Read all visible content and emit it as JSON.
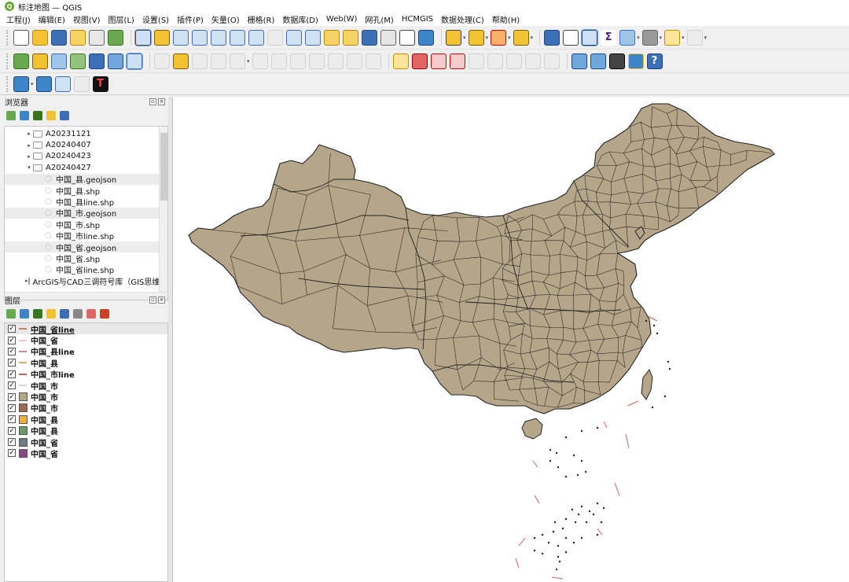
{
  "window": {
    "title": "标注地图 — QGIS",
    "logo_letter": "Q"
  },
  "menu": [
    "工程(J)",
    "编辑(E)",
    "视图(V)",
    "图层(L)",
    "设置(S)",
    "插件(P)",
    "矢量(O)",
    "栅格(R)",
    "数据库(D)",
    "Web(W)",
    "网孔(M)",
    "HCMGIS",
    "数据处理(C)",
    "帮助(H)"
  ],
  "toolbar_icons": {
    "row1": [
      {
        "name": "new-project-icon",
        "color": "#ffffff",
        "border": "#555"
      },
      {
        "name": "open-project-icon",
        "color": "#f1c232",
        "border": "#b8860b"
      },
      {
        "name": "save-project-icon",
        "color": "#3d6fb6",
        "border": "#2b4f85"
      },
      {
        "name": "new-print-layout-icon",
        "color": "#f6d365",
        "border": "#b8860b"
      },
      {
        "name": "layout-manager-icon",
        "color": "#e8e8e8",
        "border": "#666"
      },
      {
        "name": "style-manager-icon",
        "color": "#6aa84f",
        "border": "#38761d"
      },
      {
        "sep": true
      },
      {
        "name": "pan-map-icon",
        "color": "#ffffff",
        "border": "#444",
        "selected": true
      },
      {
        "name": "pan-to-selection-icon",
        "color": "#f1c232",
        "border": "#7f6000"
      },
      {
        "name": "zoom-in-icon",
        "color": "#cfe2f3",
        "border": "#3d6fb6"
      },
      {
        "name": "zoom-out-icon",
        "color": "#cfe2f3",
        "border": "#3d6fb6"
      },
      {
        "name": "zoom-full-icon",
        "color": "#cfe2f3",
        "border": "#3d6fb6"
      },
      {
        "name": "zoom-to-selection-icon",
        "color": "#cfe2f3",
        "border": "#3d6fb6"
      },
      {
        "name": "zoom-to-layer-icon",
        "color": "#cfe2f3",
        "border": "#3d6fb6"
      },
      {
        "name": "zoom-native-icon",
        "color": "#e6e6e6",
        "border": "#999",
        "disabled": true
      },
      {
        "name": "zoom-last-icon",
        "color": "#cfe2f3",
        "border": "#3d6fb6"
      },
      {
        "name": "zoom-next-icon",
        "color": "#cfe2f3",
        "border": "#3d6fb6"
      },
      {
        "name": "new-map-view-icon",
        "color": "#f6d365",
        "border": "#b8860b"
      },
      {
        "name": "new-3d-view-icon",
        "color": "#f6d365",
        "border": "#b8860b"
      },
      {
        "name": "bookmark-new-icon",
        "color": "#3d6fb6",
        "border": "#2b4f85"
      },
      {
        "name": "bookmarks-icon",
        "color": "#e6e6e6",
        "border": "#666"
      },
      {
        "name": "temporal-controller-icon",
        "color": "#ffffff",
        "border": "#444"
      },
      {
        "name": "refresh-icon",
        "color": "#3d85c6",
        "border": "#1c4587"
      },
      {
        "sep": true
      },
      {
        "name": "select-features-icon",
        "color": "#f1c232",
        "border": "#444",
        "dropdown": true
      },
      {
        "name": "select-by-value-icon",
        "color": "#f1c232",
        "border": "#7f6000",
        "dropdown": true
      },
      {
        "name": "deselect-icon",
        "color": "#f6b26b",
        "border": "#cc0000",
        "dropdown": true
      },
      {
        "name": "select-by-expression-icon",
        "color": "#f1c232",
        "border": "#7f6000",
        "dropdown": true
      },
      {
        "sep": true
      },
      {
        "name": "identify-features-icon",
        "color": "#3d6fb6",
        "border": "#1c4587"
      },
      {
        "name": "attribute-table-icon",
        "color": "#ffffff",
        "border": "#444"
      },
      {
        "name": "toolbox-gear-icon",
        "color": "#3d85c6",
        "border": "#1c4587",
        "selected": true
      },
      {
        "name": "statistics-sigma-icon",
        "color": "#ffffff",
        "border": "#ffffff",
        "glyph": "Σ",
        "glyph_color": "#4a1d8a"
      },
      {
        "name": "field-calculator-icon",
        "color": "#9fc5e8",
        "border": "#3d6fb6",
        "dropdown": true
      },
      {
        "name": "measure-line-icon",
        "color": "#999999",
        "border": "#666",
        "dropdown": true
      },
      {
        "name": "map-tips-icon",
        "color": "#ffe599",
        "border": "#bf9000",
        "dropdown": true
      },
      {
        "name": "locator-search-icon",
        "color": "#e6e6e6",
        "border": "#999",
        "disabled": true,
        "dropdown": true
      }
    ],
    "row2": [
      {
        "name": "add-vector-layer-icon",
        "color": "#6aa84f",
        "border": "#38761d"
      },
      {
        "name": "digitize-icon",
        "color": "#f1c232",
        "border": "#7f6000"
      },
      {
        "name": "add-csv-layer-icon",
        "color": "#9fc5e8",
        "border": "#3d6fb6"
      },
      {
        "name": "add-wms-icon",
        "color": "#93c47d",
        "border": "#38761d"
      },
      {
        "name": "add-raster-icon",
        "color": "#3d6fb6",
        "border": "#1c4587"
      },
      {
        "name": "add-mesh-icon",
        "color": "#6fa8dc",
        "border": "#1c4587"
      },
      {
        "name": "add-virtual-layer-icon",
        "color": "#cfe2f3",
        "border": "#3d6fb6",
        "selected": true
      },
      {
        "sep": true
      },
      {
        "name": "current-edits-icon",
        "color": "#e6e6e6",
        "border": "#999",
        "disabled": true
      },
      {
        "name": "toggle-editing-icon",
        "color": "#f1c232",
        "border": "#7f6000"
      },
      {
        "name": "save-edits-icon",
        "color": "#e6e6e6",
        "border": "#999",
        "disabled": true
      },
      {
        "name": "digitize-vertex-icon",
        "color": "#e6e6e6",
        "border": "#999",
        "disabled": true
      },
      {
        "name": "vertex-tool-icon",
        "color": "#e6e6e6",
        "border": "#999",
        "disabled": true,
        "dropdown": true
      },
      {
        "name": "modify-attributes-icon",
        "color": "#e6e6e6",
        "border": "#999",
        "disabled": true
      },
      {
        "name": "delete-selected-icon",
        "color": "#e6e6e6",
        "border": "#999",
        "disabled": true
      },
      {
        "name": "cut-features-icon",
        "color": "#e6e6e6",
        "border": "#999",
        "disabled": true
      },
      {
        "name": "copy-features-icon",
        "color": "#e6e6e6",
        "border": "#999",
        "disabled": true
      },
      {
        "name": "paste-features-icon",
        "color": "#e6e6e6",
        "border": "#999",
        "disabled": true
      },
      {
        "name": "undo-icon",
        "color": "#e6e6e6",
        "border": "#999",
        "disabled": true
      },
      {
        "name": "redo-icon",
        "color": "#e6e6e6",
        "border": "#999",
        "disabled": true
      },
      {
        "sep": true
      },
      {
        "name": "label-toolbar-icon",
        "color": "#ffe599",
        "border": "#bf9000"
      },
      {
        "name": "label-pin-icon",
        "color": "#e06666",
        "border": "#990000"
      },
      {
        "name": "label-highlight-icon",
        "color": "#f4cccc",
        "border": "#cc0000"
      },
      {
        "name": "label-show-hide-icon",
        "color": "#f4cccc",
        "border": "#cc0000"
      },
      {
        "name": "label-move-icon",
        "color": "#e6e6e6",
        "border": "#999",
        "disabled": true
      },
      {
        "name": "label-rotate-icon",
        "color": "#e6e6e6",
        "border": "#999",
        "disabled": true
      },
      {
        "name": "label-change-icon",
        "color": "#e6e6e6",
        "border": "#999",
        "disabled": true
      },
      {
        "name": "diagram-move-icon",
        "color": "#e6e6e6",
        "border": "#999",
        "disabled": true
      },
      {
        "name": "label-properties-icon",
        "color": "#e6e6e6",
        "border": "#999",
        "disabled": true
      },
      {
        "sep": true
      },
      {
        "name": "georef-icon",
        "color": "#6fa8dc",
        "border": "#1c4587"
      },
      {
        "name": "metasearch-icon",
        "color": "#6fa8dc",
        "border": "#1c4587"
      },
      {
        "name": "network-analysis-icon",
        "color": "#444444",
        "border": "#000"
      },
      {
        "name": "python-console-icon",
        "color": "#3d85c6",
        "border": "#f1c232"
      },
      {
        "name": "help-icon",
        "color": "#3d6fb6",
        "border": "#1c4587",
        "glyph": "?",
        "glyph_color": "#ffffff"
      }
    ],
    "row3": [
      {
        "name": "data-source-manager-icon",
        "color": "#3d85c6",
        "border": "#1c4587",
        "dropdown": true
      },
      {
        "name": "settings-gear-icon",
        "color": "#3d85c6",
        "border": "#1c4587"
      },
      {
        "name": "search-icon",
        "color": "#cfe2f3",
        "border": "#3d6fb6"
      },
      {
        "name": "resize-canvas-icon",
        "color": "#e6e6e6",
        "border": "#999",
        "disabled": true
      },
      {
        "name": "terminal-plugin-icon",
        "color": "#111111",
        "border": "#111",
        "glyph": "T",
        "glyph_color": "#ff4444"
      }
    ]
  },
  "browser_panel": {
    "title": "浏览器",
    "toolbar_icons": [
      "add-selected-icon",
      "refresh-icon",
      "filter-icon",
      "collapse-icon",
      "info-icon"
    ],
    "items": [
      {
        "label": "A20231121",
        "type": "folder",
        "level": 1,
        "expanded": false
      },
      {
        "label": "A20240407",
        "type": "folder",
        "level": 1,
        "expanded": false
      },
      {
        "label": "A20240423",
        "type": "folder",
        "level": 1,
        "expanded": false
      },
      {
        "label": "A20240427",
        "type": "folder",
        "level": 1,
        "expanded": true
      },
      {
        "label": "中国_县.geojson",
        "type": "layer",
        "level": 2,
        "shade": true
      },
      {
        "label": "中国_县.shp",
        "type": "layer",
        "level": 2
      },
      {
        "label": "中国_县line.shp",
        "type": "layer",
        "level": 2
      },
      {
        "label": "中国_市.geojson",
        "type": "layer",
        "level": 2,
        "shade": true
      },
      {
        "label": "中国_市.shp",
        "type": "layer",
        "level": 2
      },
      {
        "label": "中国_市line.shp",
        "type": "layer",
        "level": 2
      },
      {
        "label": "中国_省.geojson",
        "type": "layer",
        "level": 2,
        "shade": true
      },
      {
        "label": "中国_省.shp",
        "type": "layer",
        "level": 2
      },
      {
        "label": "中国_省line.shp",
        "type": "layer",
        "level": 2
      },
      {
        "label": "ArcGIS与CAD三调符号库（GIS思维）",
        "type": "folder",
        "level": 1,
        "expanded": false
      }
    ]
  },
  "layers_panel": {
    "title": "图层",
    "toolbar_icons": [
      "open-styling-icon",
      "add-group-icon",
      "manage-visibility-icon",
      "filter-legend-icon",
      "filter-expression-icon",
      "expand-all-icon",
      "collapse-all-icon",
      "remove-layer-icon"
    ],
    "layers": [
      {
        "label": "中国_省line",
        "symbol": "line",
        "color": "#c4826e",
        "checked": true,
        "active": true
      },
      {
        "label": "中国_省",
        "symbol": "line",
        "color": "#f0c8c8",
        "checked": true
      },
      {
        "label": "中国_县line",
        "symbol": "line",
        "color": "#c98a9a",
        "checked": true
      },
      {
        "label": "中国_县",
        "symbol": "line",
        "color": "#d6b070",
        "checked": true
      },
      {
        "label": "中国_市line",
        "symbol": "line",
        "color": "#b56a6a",
        "checked": true
      },
      {
        "label": "中国_市",
        "symbol": "line",
        "color": "#c8d8e8",
        "checked": true
      },
      {
        "label": "中国_市",
        "symbol": "fill",
        "color": "#b5a68a",
        "checked": true
      },
      {
        "label": "中国_市",
        "symbol": "fill",
        "color": "#9d6a4a",
        "checked": true
      },
      {
        "label": "中国_县",
        "symbol": "fill",
        "color": "#e8b53a",
        "checked": true
      },
      {
        "label": "中国_县",
        "symbol": "fill",
        "color": "#6a9a6a",
        "checked": true
      },
      {
        "label": "中国_省",
        "symbol": "fill",
        "color": "#707c84",
        "checked": true
      },
      {
        "label": "中国_省",
        "symbol": "fill",
        "color": "#8a4a8a",
        "checked": true
      }
    ]
  },
  "map": {
    "fill_color": "#b5a68a",
    "boundary_color": "#222222",
    "background": "#ffffff",
    "accent_line_color": "#d06060"
  }
}
